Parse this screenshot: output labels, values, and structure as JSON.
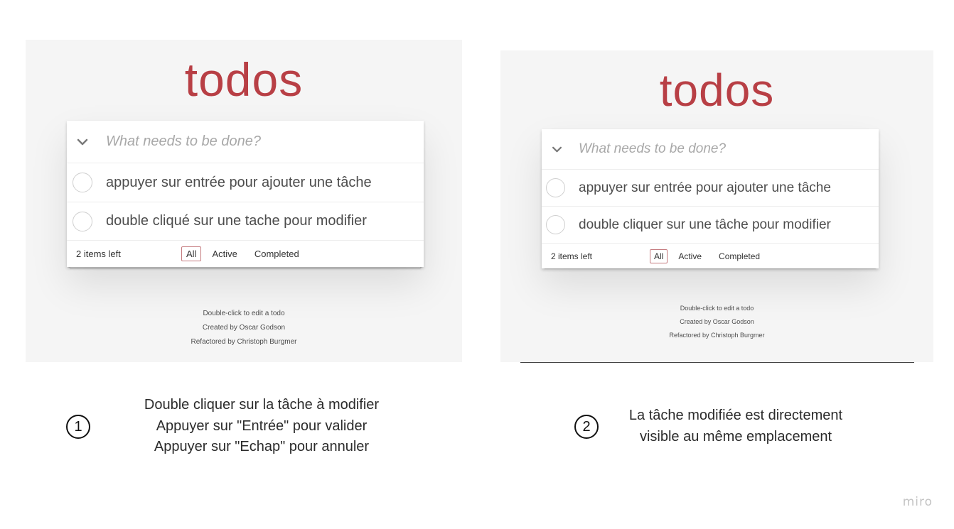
{
  "screens": [
    {
      "title": "todos",
      "new_todo_placeholder": "What needs to be done?",
      "todos": [
        {
          "text": "appuyer sur entrée pour ajouter une tâche",
          "completed": false
        },
        {
          "text": "double cliqué sur une tache pour modifier",
          "completed": false
        }
      ],
      "items_left": "2 items left",
      "filters": [
        "All",
        "Active",
        "Completed"
      ],
      "selected_filter": "All",
      "info": [
        "Double-click to edit a todo",
        "Created by Oscar Godson",
        "Refactored by Christoph Burgmer"
      ]
    },
    {
      "title": "todos",
      "new_todo_placeholder": "What needs to be done?",
      "todos": [
        {
          "text": "appuyer sur entrée pour ajouter une tâche",
          "completed": false
        },
        {
          "text": "double cliquer sur une tâche pour modifier",
          "completed": false
        }
      ],
      "items_left": "2 items left",
      "filters": [
        "All",
        "Active",
        "Completed"
      ],
      "selected_filter": "All",
      "info": [
        "Double-click to edit a todo",
        "Created by Oscar Godson",
        "Refactored by Christoph Burgmer"
      ]
    }
  ],
  "steps": [
    {
      "number": "1",
      "lines": [
        "Double cliquer sur la tâche à modifier",
        "Appuyer sur \"Entrée\" pour valider",
        "Appuyer sur \"Echap\" pour annuler"
      ]
    },
    {
      "number": "2",
      "lines": [
        "La tâche modifiée est directement",
        "visible au même emplacement"
      ]
    }
  ],
  "watermark": "miro",
  "colors": {
    "title": "#b83f45",
    "panel_bg": "#f5f5f5",
    "selected_filter_border": "#c57b7f"
  },
  "icons": {
    "toggle_all": "chevron-down-icon",
    "todo_checkbox": "circle-checkbox-icon"
  }
}
